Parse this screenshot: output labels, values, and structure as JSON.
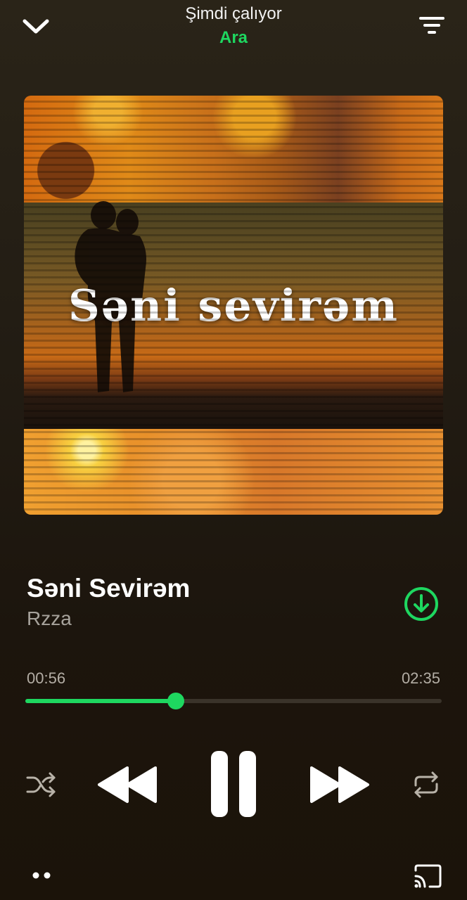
{
  "header": {
    "title": "Şimdi çalıyor",
    "subtitle": "Ara",
    "collapse_icon": "chevron-down-icon",
    "menu_icon": "filter-lines-icon"
  },
  "artwork": {
    "text": "Səni sevirəm"
  },
  "track": {
    "title": "Səni Sevirəm",
    "artist": "Rzza",
    "download_icon": "download-circle-icon"
  },
  "progress": {
    "elapsed": "00:56",
    "duration": "02:35",
    "fraction": 0.361
  },
  "controls": {
    "shuffle_icon": "shuffle-icon",
    "previous_icon": "rewind-icon",
    "play_pause_icon": "pause-icon",
    "next_icon": "fast-forward-icon",
    "repeat_icon": "repeat-icon"
  },
  "footer": {
    "more_icon": "more-dots-icon",
    "cast_icon": "cast-icon"
  },
  "colors": {
    "accent": "#1ed760",
    "background": "#231d14",
    "secondary_text": "#a7a39c"
  }
}
